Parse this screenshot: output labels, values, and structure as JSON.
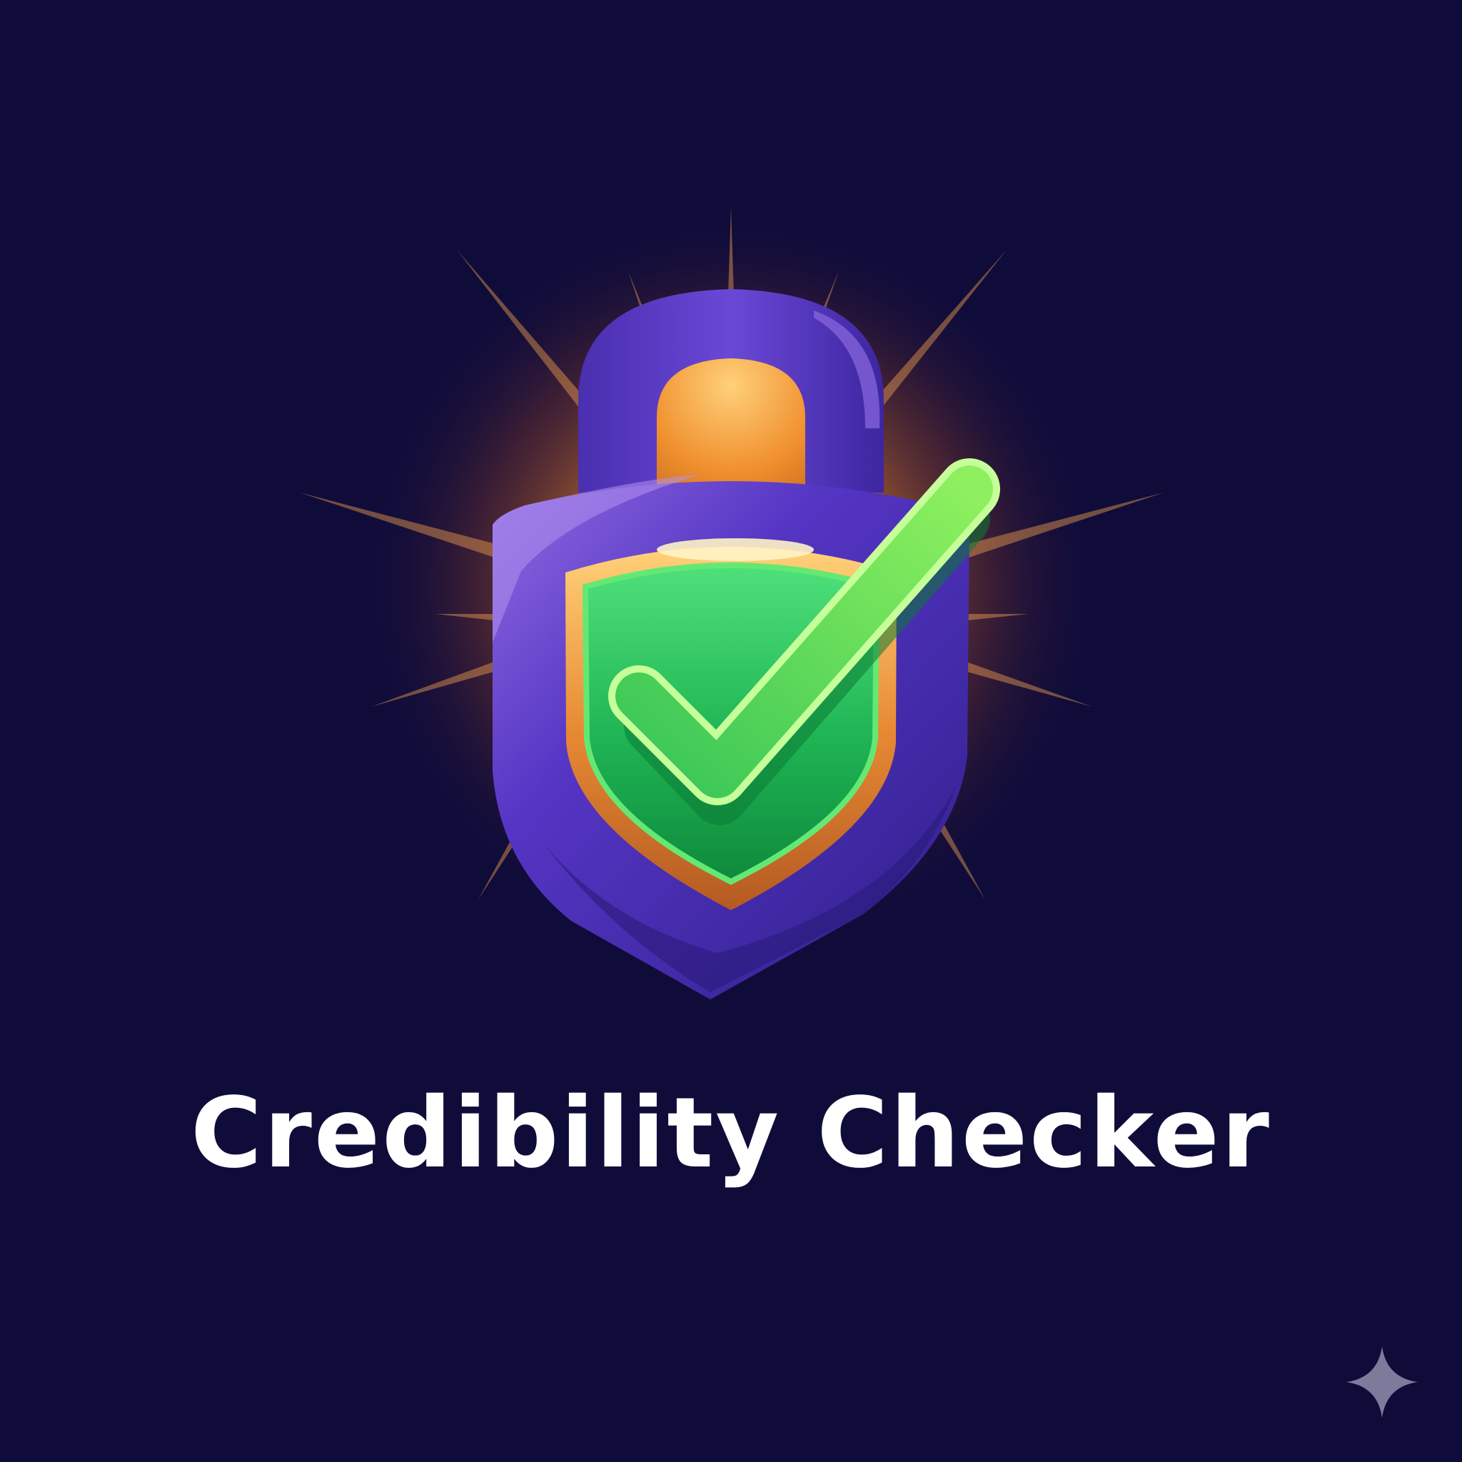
{
  "title": "Credibility Checker",
  "icons": {
    "emblem": "padlock-shield-checkmark-icon",
    "corner": "sparkle-icon"
  },
  "colors": {
    "background": "#100c3a",
    "lock_body": "#4b2bb0",
    "lock_highlight": "#a07de6",
    "glow": "#f08a2a",
    "shield_rim": "#e89a3c",
    "shield_fill": "#1fb454",
    "check": "#7fe35a",
    "title_text": "#ffffff",
    "sparkle": "#7d7a9c"
  }
}
